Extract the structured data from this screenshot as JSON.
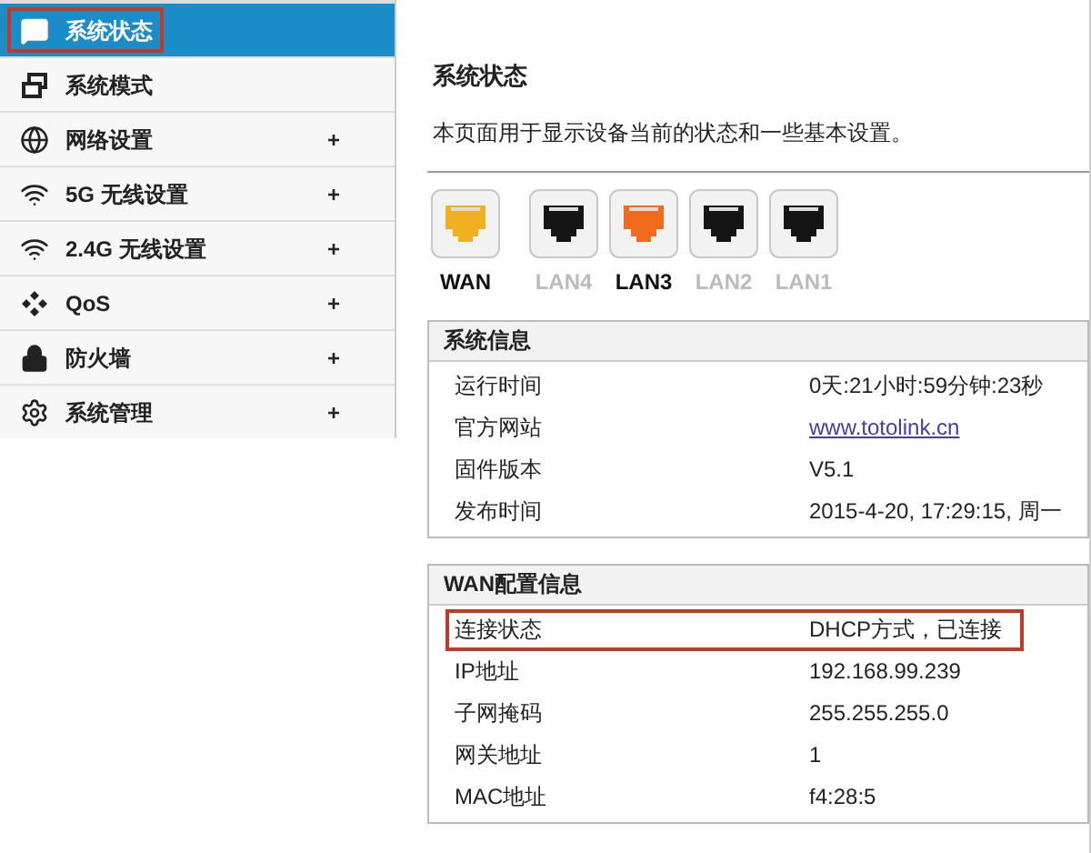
{
  "sidebar": {
    "items": [
      {
        "label": "系统状态",
        "selected": true,
        "highlighted": true
      },
      {
        "label": "系统模式",
        "selected": false,
        "highlighted": false
      },
      {
        "label": "网络设置",
        "selected": false,
        "highlighted": false,
        "expander": "+"
      },
      {
        "label": "5G 无线设置",
        "selected": false,
        "highlighted": false,
        "expander": "+"
      },
      {
        "label": "2.4G 无线设置",
        "selected": false,
        "highlighted": false,
        "expander": "+"
      },
      {
        "label": "QoS",
        "selected": false,
        "highlighted": false,
        "expander": "+"
      },
      {
        "label": "防火墙",
        "selected": false,
        "highlighted": false,
        "expander": "+"
      },
      {
        "label": "系统管理",
        "selected": false,
        "highlighted": false,
        "expander": "+"
      }
    ]
  },
  "page": {
    "title": "系统状态",
    "description": "本页面用于显示设备当前的状态和一些基本设置。"
  },
  "ports": [
    {
      "label": "WAN",
      "connected": true,
      "color": "#f0b020"
    },
    {
      "label": "LAN4",
      "connected": false,
      "color": "#151515"
    },
    {
      "label": "LAN3",
      "connected": true,
      "color": "#f26b1d"
    },
    {
      "label": "LAN2",
      "connected": false,
      "color": "#151515"
    },
    {
      "label": "LAN1",
      "connected": false,
      "color": "#151515"
    }
  ],
  "sections": [
    {
      "title": "系统信息",
      "rows": [
        {
          "label": "运行时间",
          "value": "0天:21小时:59分钟:23秒",
          "kind": "text",
          "highlighted": false
        },
        {
          "label": "官方网站",
          "value": "www.totolink.cn",
          "kind": "link",
          "highlighted": false
        },
        {
          "label": "固件版本",
          "value": "V5.1",
          "kind": "text",
          "highlighted": false
        },
        {
          "label": "发布时间",
          "value": "2015-4-20, 17:29:15, 周一",
          "kind": "text",
          "highlighted": false
        }
      ]
    },
    {
      "title": "WAN配置信息",
      "rows": [
        {
          "label": "连接状态",
          "value": "DHCP方式，已连接",
          "kind": "text",
          "highlighted": true
        },
        {
          "label": "IP地址",
          "value": "192.168.99.239",
          "kind": "text",
          "highlighted": false
        },
        {
          "label": "子网掩码",
          "value": "255.255.255.0",
          "kind": "text",
          "highlighted": false
        },
        {
          "label": "网关地址",
          "value": "1",
          "kind": "text",
          "highlighted": false
        },
        {
          "label": "MAC地址",
          "value": "f4:28:5",
          "kind": "text",
          "highlighted": false
        }
      ]
    }
  ]
}
